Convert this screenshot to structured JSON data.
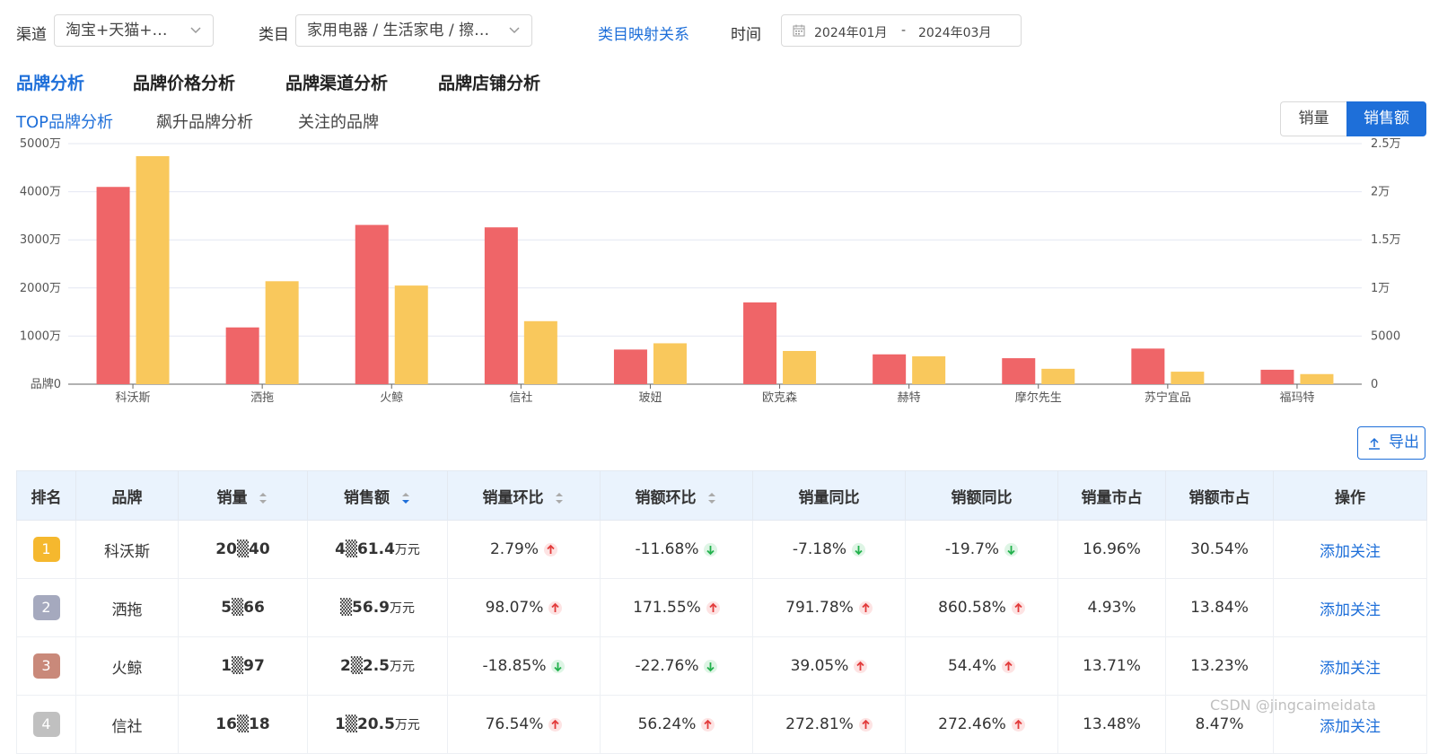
{
  "filters": {
    "channel_label": "渠道",
    "channel_value": "淘宝+天猫+京东",
    "category_label": "类目",
    "category_value": "家用电器 / 生活家电 / 擦地机/拖地机",
    "mapping_link": "类目映射关系",
    "time_label": "时间",
    "date_start": "2024年01月",
    "date_sep": "-",
    "date_end": "2024年03月"
  },
  "tabs_primary": [
    {
      "label": "品牌分析",
      "active": true
    },
    {
      "label": "品牌价格分析",
      "active": false
    },
    {
      "label": "品牌渠道分析",
      "active": false
    },
    {
      "label": "品牌店铺分析",
      "active": false
    }
  ],
  "tabs_secondary": [
    {
      "label": "TOP品牌分析",
      "active": true
    },
    {
      "label": "飙升品牌分析",
      "active": false
    },
    {
      "label": "关注的品牌",
      "active": false
    }
  ],
  "metric_toggle": {
    "volume": "销量",
    "amount": "销售额",
    "selected": "销售额"
  },
  "chart_data": {
    "type": "bar",
    "categories": [
      "科沃斯",
      "洒拖",
      "火鲸",
      "信社",
      "玻妞",
      "欧克森",
      "赫特",
      "摩尔先生",
      "苏宁宜品",
      "福玛特"
    ],
    "series": [
      {
        "values": [
          4100,
          1180,
          3310,
          3260,
          720,
          1700,
          620,
          540,
          740,
          300
        ],
        "color": "#ef6568",
        "axis": "left"
      },
      {
        "values": [
          23700,
          10700,
          10250,
          6550,
          4250,
          3450,
          2900,
          1600,
          1300,
          1050
        ],
        "color": "#f9c85c",
        "axis": "right"
      }
    ],
    "y_left": {
      "ticks": [
        "品牌0",
        "1000万",
        "2000万",
        "3000万",
        "4000万",
        "5000万"
      ],
      "max": 5000
    },
    "y_right": {
      "ticks": [
        "0",
        "5000",
        "1万",
        "1.5万",
        "2万",
        "2.5万"
      ],
      "max": 25000
    },
    "grid": true
  },
  "export_label": "导出",
  "table": {
    "headers": [
      "排名",
      "品牌",
      "销量",
      "销售额",
      "销量环比",
      "销额环比",
      "销量同比",
      "销额同比",
      "销量市占",
      "销额市占",
      "操作"
    ],
    "rows": [
      {
        "rank": "1",
        "rank_color": "#f5b82e",
        "brand": "科沃斯",
        "volume": "20▒40",
        "amount": "4▒61.4",
        "unit": "万元",
        "vol_mom": "2.79%",
        "vol_mom_dir": "up",
        "amt_mom": "-11.68%",
        "amt_mom_dir": "down",
        "vol_yoy": "-7.18%",
        "vol_yoy_dir": "down",
        "amt_yoy": "-19.7%",
        "amt_yoy_dir": "down",
        "vol_share": "16.96%",
        "amt_share": "30.54%",
        "action": "添加关注"
      },
      {
        "rank": "2",
        "rank_color": "#a5a9be",
        "brand": "洒拖",
        "volume": "5▒66",
        "amount": "▒56.9",
        "unit": "万元",
        "vol_mom": "98.07%",
        "vol_mom_dir": "up",
        "amt_mom": "171.55%",
        "amt_mom_dir": "up",
        "vol_yoy": "791.78%",
        "vol_yoy_dir": "up",
        "amt_yoy": "860.58%",
        "amt_yoy_dir": "up",
        "vol_share": "4.93%",
        "amt_share": "13.84%",
        "action": "添加关注"
      },
      {
        "rank": "3",
        "rank_color": "#c9897a",
        "brand": "火鲸",
        "volume": "1▒97",
        "amount": "2▒2.5",
        "unit": "万元",
        "vol_mom": "-18.85%",
        "vol_mom_dir": "down",
        "amt_mom": "-22.76%",
        "amt_mom_dir": "down",
        "vol_yoy": "39.05%",
        "vol_yoy_dir": "up",
        "amt_yoy": "54.4%",
        "amt_yoy_dir": "up",
        "vol_share": "13.71%",
        "amt_share": "13.23%",
        "action": "添加关注"
      },
      {
        "rank": "4",
        "rank_color": "#c0c0c0",
        "brand": "信社",
        "volume": "16▒18",
        "amount": "1▒20.5",
        "unit": "万元",
        "vol_mom": "76.54%",
        "vol_mom_dir": "up",
        "amt_mom": "56.24%",
        "amt_mom_dir": "up",
        "vol_yoy": "272.81%",
        "vol_yoy_dir": "up",
        "amt_yoy": "272.46%",
        "amt_yoy_dir": "up",
        "vol_share": "13.48%",
        "amt_share": "8.47%",
        "action": "添加关注"
      }
    ]
  },
  "watermark": "CSDN @jingcaimeidata",
  "colors": {
    "accent": "#1e6fd9",
    "up": "#e23b3b",
    "down": "#22b14c",
    "header_bg": "#eaf3fd"
  }
}
